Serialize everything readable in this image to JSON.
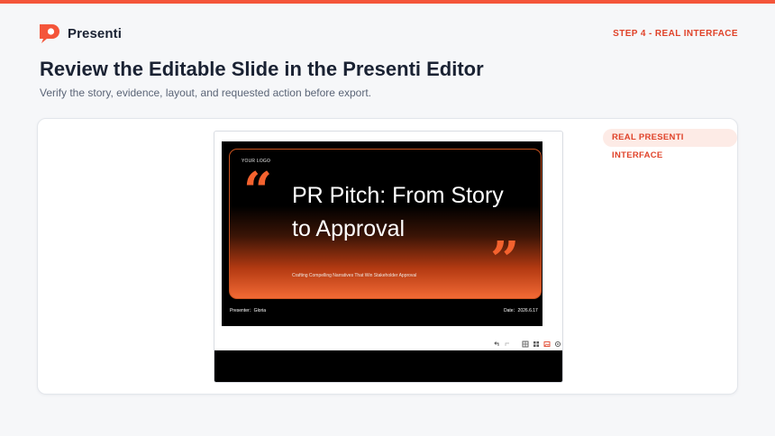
{
  "brand": {
    "name": "Presenti",
    "logo_icon": "presenti-logo-icon",
    "accent_color": "#f4553a"
  },
  "header": {
    "step_label": "STEP 4 - REAL INTERFACE"
  },
  "page": {
    "title": "Review the Editable Slide in the Presenti Editor",
    "subtitle": "Verify the story, evidence, layout, and requested action before export."
  },
  "card": {
    "badge": "REAL PRESENTI INTERFACE"
  },
  "slide": {
    "logo_text": "YOUR LOGO",
    "open_quote": "“",
    "close_quote": "”",
    "title": "PR Pitch: From Story to Approval",
    "subtitle": "Crafting Compelling Narratives That Win Stakeholder Approval",
    "presenter": "Presenter：Gloria",
    "date": "Date：2026.6.17",
    "accent_color": "#f4622e"
  },
  "toolbar": {
    "icons": [
      "undo-icon",
      "redo-icon",
      "table-icon",
      "grid-icon",
      "image-icon",
      "settings-icon",
      "fullscreen-icon"
    ]
  }
}
